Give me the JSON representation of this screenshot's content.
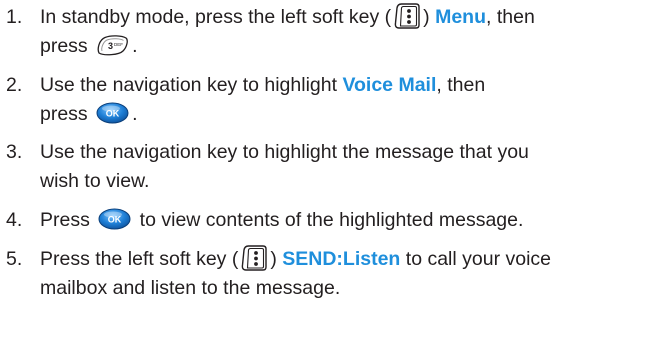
{
  "steps": [
    {
      "number": "1.",
      "text_a": "In standby mode, press the left soft key (",
      "text_b": ") ",
      "menu_label": "Menu",
      "text_c": ", then",
      "text_d": "press ",
      "text_e": ".",
      "key_icon_label": "3 DEF"
    },
    {
      "number": "2.",
      "text_a": "Use the navigation key to highlight ",
      "highlight_label": "Voice Mail",
      "text_b": ", then",
      "text_c": "press ",
      "text_d": ".",
      "ok_icon_label": "OK"
    },
    {
      "number": "3.",
      "text_a": "Use the navigation key to highlight the message that you",
      "text_b": "wish to view."
    },
    {
      "number": "4.",
      "text_a": "Press ",
      "text_b": " to view contents of the highlighted message.",
      "ok_icon_label": "OK"
    },
    {
      "number": "5.",
      "text_a": "Press the left soft key (",
      "text_b": ") ",
      "action_label": "SEND:Listen",
      "text_c": " to call your voice",
      "text_d": "mailbox and listen to the message."
    }
  ],
  "colors": {
    "text": "#231f20",
    "accent": "#1f8fdc"
  },
  "icons": {
    "soft_key": "left-soft-key-icon",
    "key_3": "key-3-icon",
    "ok_key": "ok-key-icon"
  }
}
